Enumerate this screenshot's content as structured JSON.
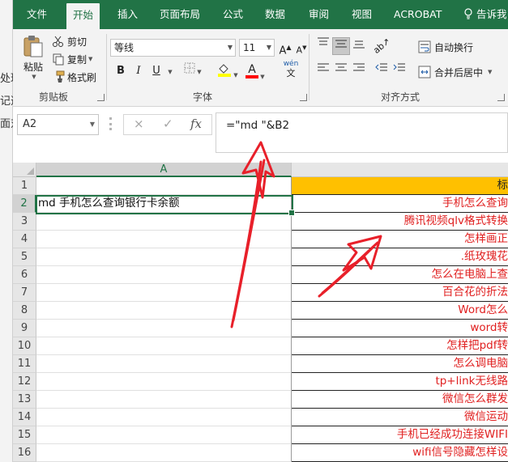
{
  "background_window": {
    "fragments": [
      "处理",
      "记选",
      "面对"
    ]
  },
  "ribbon_tabs": [
    "文件",
    "开始",
    "插入",
    "页面布局",
    "公式",
    "数据",
    "审阅",
    "视图",
    "ACROBAT",
    "告诉我"
  ],
  "active_tab": "开始",
  "clipboard": {
    "paste_label": "粘贴",
    "cut_label": "剪切",
    "copy_label": "复制",
    "format_painter_label": "格式刷",
    "group_label": "剪贴板"
  },
  "font": {
    "font_name": "等线",
    "font_size": "11",
    "grow_label": "A",
    "shrink_label": "A",
    "bold_label": "B",
    "italic_label": "I",
    "underline_label": "U",
    "fill_color": "#ffff00",
    "font_color_hex": "#ff0000",
    "font_color_letter": "A",
    "phonetic_top": "wén",
    "phonetic_bottom": "文",
    "group_label": "字体"
  },
  "alignment": {
    "wrap_text_label": "自动换行",
    "merge_center_label": "合并后居中",
    "group_label": "对齐方式"
  },
  "formula_bar": {
    "name_box": "A2",
    "cancel_icon": "×",
    "enter_icon": "✓",
    "fx_label": "fx",
    "formula": "=\"md \"&B2"
  },
  "sheet": {
    "columns": [
      "A"
    ],
    "row_numbers": [
      "1",
      "2",
      "3",
      "4",
      "5",
      "6",
      "7",
      "8",
      "9",
      "10",
      "11",
      "12",
      "13",
      "14",
      "15",
      "16"
    ],
    "col_a": [
      "",
      "md 手机怎么查询银行卡余额",
      "",
      "",
      "",
      "",
      "",
      "",
      "",
      "",
      "",
      "",
      "",
      "",
      "",
      ""
    ],
    "col_b": [
      "标",
      "手机怎么查询",
      "腾讯视频qlv格式转换",
      "怎样画正",
      ".纸玫瑰花",
      "怎么在电脑上查",
      "百合花的折法",
      "Word怎么",
      "word转",
      "怎样把pdf转",
      "怎么调电脑",
      "tp+link无线路",
      "微信怎么群发",
      "微信运动",
      "手机已经成功连接WIFI",
      "wifi信号隐藏怎样设"
    ],
    "header_fill": "#ffc000",
    "col_b_text_color": "#e02020",
    "selected_cell": "A2"
  },
  "annotation_color": "#e8202a"
}
